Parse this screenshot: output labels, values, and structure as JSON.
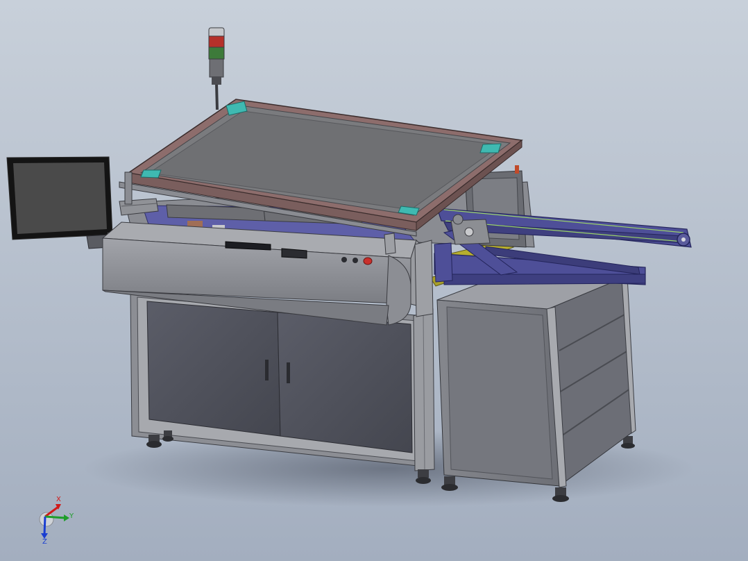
{
  "viewport": {
    "background_top": "#c7cfda",
    "background_bottom": "#a8b3c4"
  },
  "model": {
    "body_color": "#8a8c92",
    "panel_color": "#50525c",
    "frame_color": "#9a9ca2",
    "arm_color": "#4e4f98",
    "tray_frame_color": "#8d6d6c",
    "tray_color": "#7d7e80",
    "conveyor_color": "#b7ae2e",
    "accent_cyan": "#37b8b2",
    "emergency_stop_color": "#c9302c"
  },
  "triad": {
    "x_label": "X",
    "y_label": "Y",
    "z_label": "Z",
    "x_color": "#d11a1a",
    "y_color": "#1e9e2a",
    "z_color": "#1a3ed1"
  }
}
